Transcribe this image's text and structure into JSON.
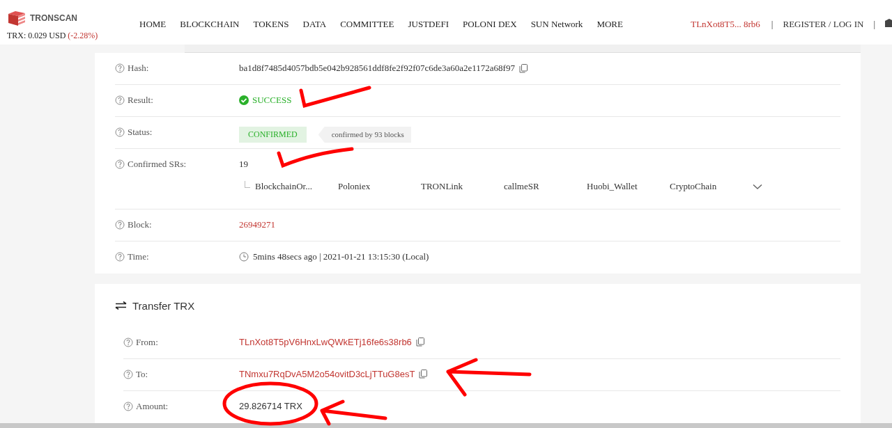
{
  "header": {
    "logo_text": "TRONSCAN",
    "price": {
      "text": "TRX: 0.029 USD",
      "change": "(-2.28%)"
    },
    "nav": [
      "HOME",
      "BLOCKCHAIN",
      "TOKENS",
      "DATA",
      "COMMITTEE",
      "JUSTDEFI",
      "POLONI DEX",
      "SUN Network",
      "MORE"
    ],
    "account": "TLnXot8T5... 8rb6",
    "separator": "|",
    "register": "REGISTER / LOG IN",
    "separator_2": "|"
  },
  "details": [
    {
      "label": "Hash:",
      "kind": "hash",
      "value": "ba1d8f7485d4057bdb5e042b928561ddf8fe2f92f07c6de3a60a2e1172a68f97"
    },
    {
      "label": "Result:",
      "kind": "result",
      "value": "SUCCESS"
    },
    {
      "label": "Status:",
      "kind": "status",
      "value": "CONFIRMED",
      "note": "confirmed by 93 blocks"
    },
    {
      "label": "Confirmed SRs:",
      "kind": "srs",
      "value": "19",
      "srs": [
        "BlockchainOr...",
        "Poloniex",
        "TRONLink",
        "callmeSR",
        "Huobi_Wallet",
        "CryptoChain"
      ]
    },
    {
      "label": "Block:",
      "kind": "link",
      "value": "26949271"
    },
    {
      "label": "Time:",
      "kind": "time",
      "value": "5mins 48secs ago | 2021-01-21 13:15:30 (Local)"
    }
  ],
  "transfer": {
    "title": "Transfer TRX",
    "rows": [
      {
        "label": "From:",
        "kind": "address",
        "value": "TLnXot8T5pV6HnxLwQWkETj16fe6s38rb6"
      },
      {
        "label": "To:",
        "kind": "address",
        "value": "TNmxu7RqDvA5M2o54ovitD3cLjTTuG8esT"
      },
      {
        "label": "Amount:",
        "kind": "amount",
        "value": "29.826714 TRX"
      }
    ]
  }
}
